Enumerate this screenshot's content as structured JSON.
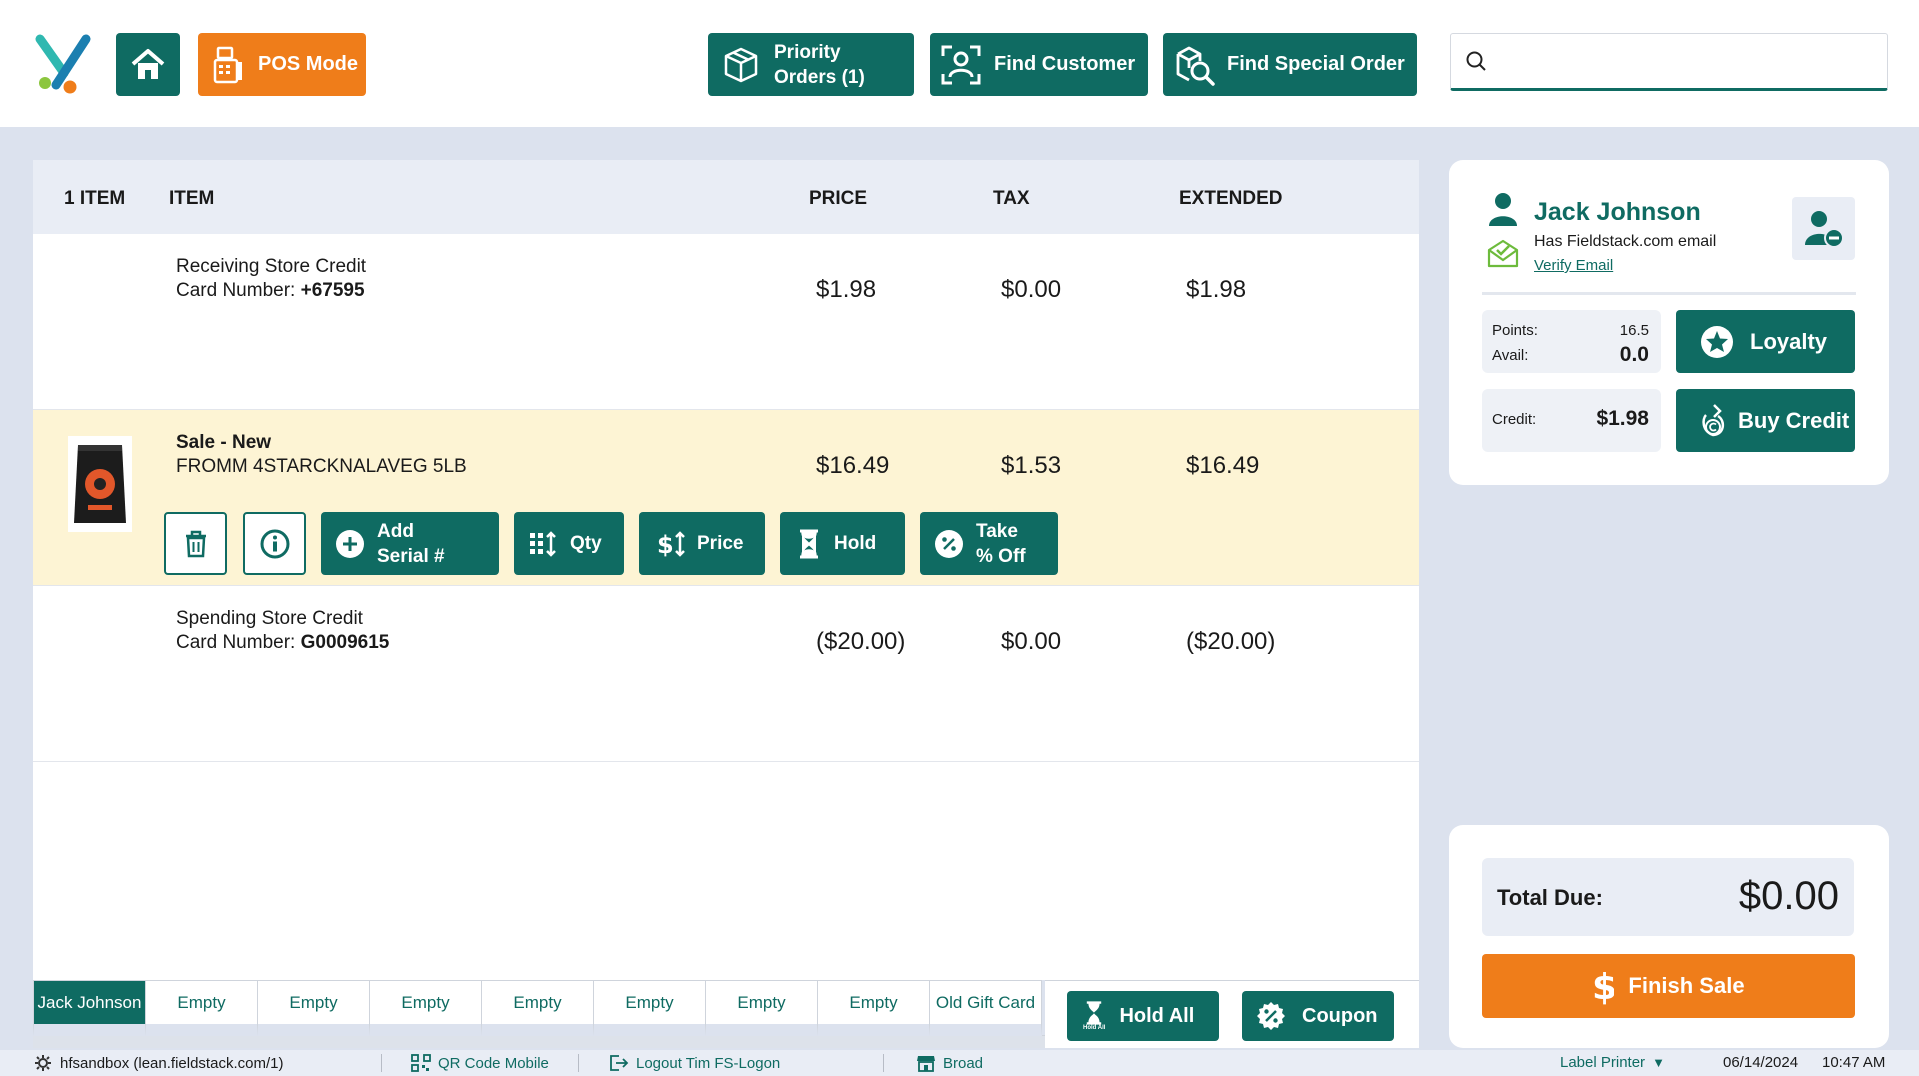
{
  "header": {
    "pos_mode_label": "POS Mode",
    "priority_line1": "Priority",
    "priority_line2": "Orders (1)",
    "find_customer_label": "Find Customer",
    "find_special_order_label": "Find Special Order",
    "search_placeholder": ""
  },
  "table": {
    "col_count": "1 ITEM",
    "col_item": "ITEM",
    "col_price": "PRICE",
    "col_tax": "TAX",
    "col_extended": "EXTENDED"
  },
  "rows": [
    {
      "line1": "Receiving Store Credit",
      "line2_label": "Card Number:",
      "line2_value": "+67595",
      "price": "$1.98",
      "tax": "$0.00",
      "extended": "$1.98"
    },
    {
      "line1": "Sale - New",
      "line2": "FROMM 4STARCKNALAVEG 5LB",
      "price": "$16.49",
      "tax": "$1.53",
      "extended": "$16.49",
      "buttons": {
        "add_serial_1": "Add",
        "add_serial_2": "Serial #",
        "qty": "Qty",
        "price": "Price",
        "hold": "Hold",
        "take_off_1": "Take",
        "take_off_2": "% Off"
      }
    },
    {
      "line1": "Spending Store Credit",
      "line2_label": "Card Number:",
      "line2_value": "G0009615",
      "price": "($20.00)",
      "tax": "$0.00",
      "extended": "($20.00)"
    }
  ],
  "tabs": [
    "Jack Johnson",
    "Empty",
    "Empty",
    "Empty",
    "Empty",
    "Empty",
    "Empty",
    "Empty",
    "Old Gift Card"
  ],
  "actions": {
    "hold_all": "Hold All",
    "hold_all_small": "Hold All",
    "coupon": "Coupon"
  },
  "customer": {
    "name": "Jack Johnson",
    "email_status": "Has Fieldstack.com email",
    "verify_email": "Verify Email",
    "points_label": "Points:",
    "points_value": "16.5",
    "avail_label": "Avail:",
    "avail_value": "0.0",
    "loyalty_label": "Loyalty",
    "credit_label": "Credit:",
    "credit_value": "$1.98",
    "buy_credit_label": "Buy Credit"
  },
  "totals": {
    "total_due_label": "Total Due:",
    "total_due_value": "$0.00",
    "finish_sale_label": "Finish Sale"
  },
  "footer": {
    "server": "hfsandbox (lean.fieldstack.com/1)",
    "qr": "QR Code Mobile",
    "logout": "Logout Tim FS-Logon",
    "store": "Broad",
    "printer": "Label Printer",
    "date": "06/14/2024",
    "time": "10:47 AM"
  },
  "colors": {
    "teal": "#0f6b62",
    "orange": "#ef7d1a",
    "highlight_row": "#fdf4d4",
    "background": "#dce2ee"
  }
}
